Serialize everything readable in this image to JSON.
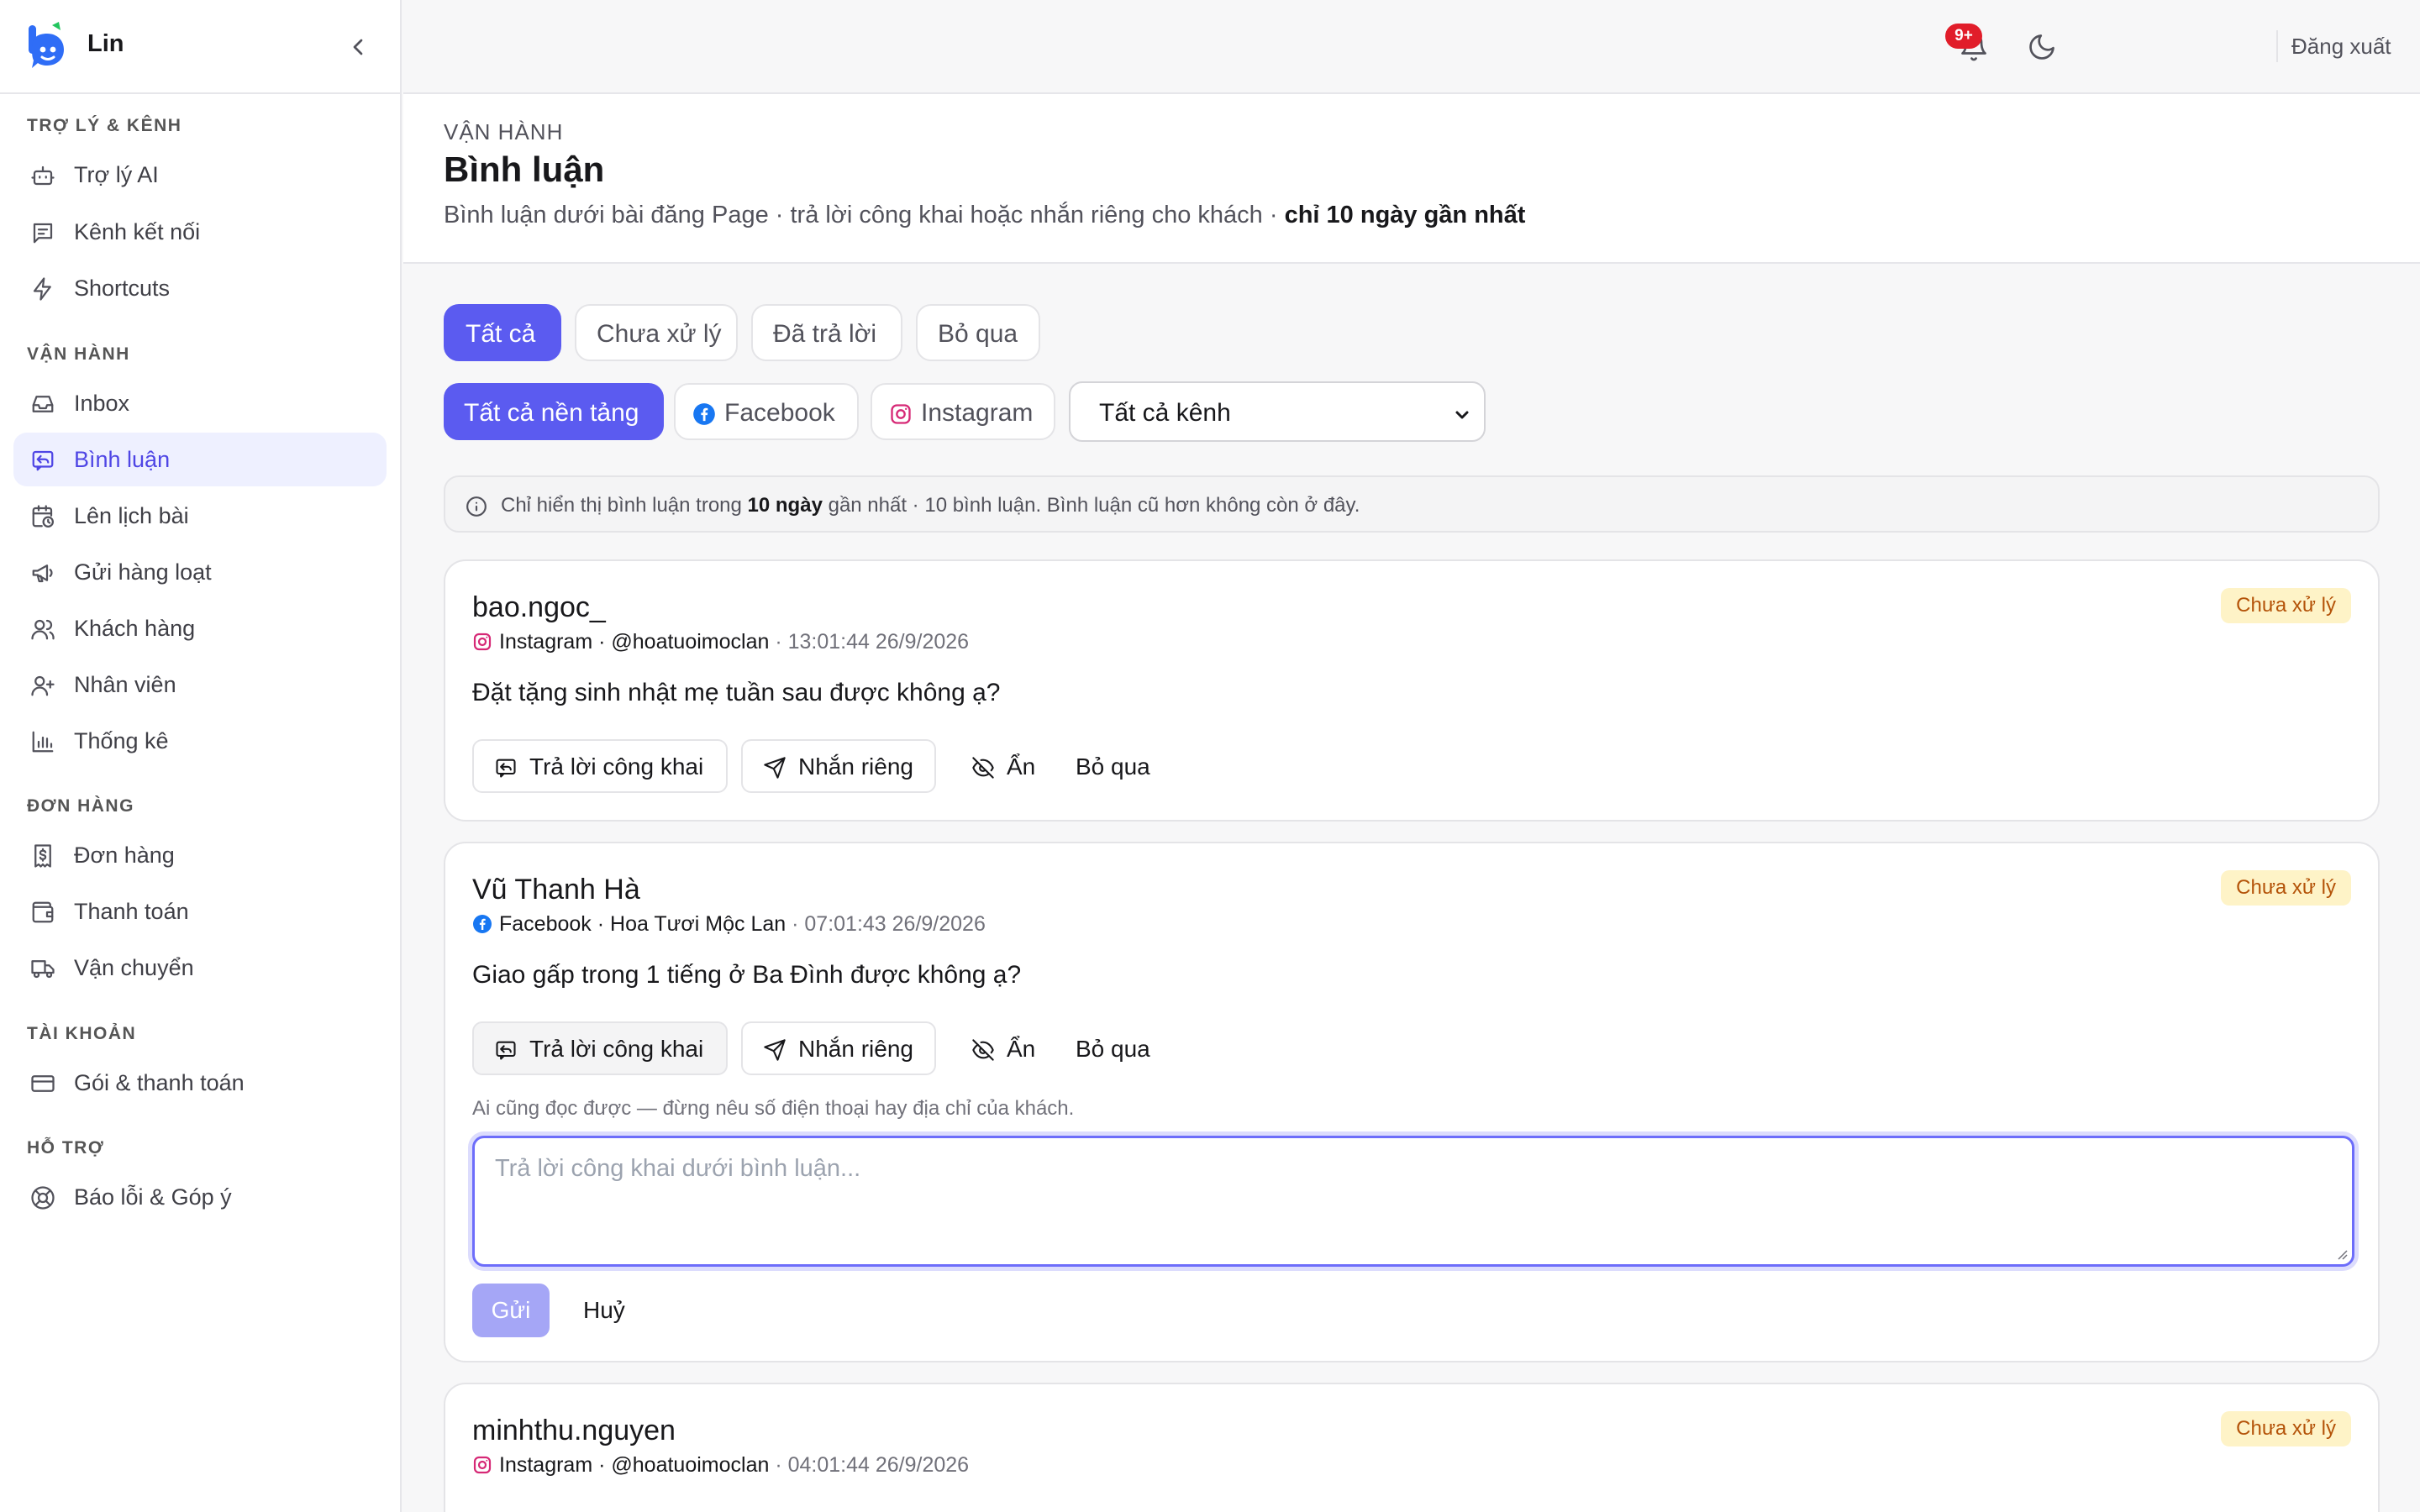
{
  "brand": {
    "name": "Lin",
    "accent": "#5b5bf0"
  },
  "sidebar": {
    "sections": [
      {
        "title": "TRỢ LÝ & KÊNH",
        "items": [
          {
            "label": "Trợ lý AI",
            "icon": "bot-icon"
          },
          {
            "label": "Kênh kết nối",
            "icon": "channels-icon"
          },
          {
            "label": "Shortcuts",
            "icon": "zap-icon"
          }
        ]
      },
      {
        "title": "VẬN HÀNH",
        "items": [
          {
            "label": "Inbox",
            "icon": "inbox-icon"
          },
          {
            "label": "Bình luận",
            "icon": "comment-reply-icon",
            "active": true
          },
          {
            "label": "Lên lịch bài",
            "icon": "calendar-clock-icon"
          },
          {
            "label": "Gửi hàng loạt",
            "icon": "megaphone-icon"
          },
          {
            "label": "Khách hàng",
            "icon": "users-icon"
          },
          {
            "label": "Nhân viên",
            "icon": "user-plus-icon"
          },
          {
            "label": "Thống kê",
            "icon": "bar-chart-icon"
          }
        ]
      },
      {
        "title": "ĐƠN HÀNG",
        "items": [
          {
            "label": "Đơn hàng",
            "icon": "receipt-icon"
          },
          {
            "label": "Thanh toán",
            "icon": "wallet-icon"
          },
          {
            "label": "Vận chuyển",
            "icon": "truck-icon"
          }
        ]
      },
      {
        "title": "TÀI KHOẢN",
        "items": [
          {
            "label": "Gói & thanh toán",
            "icon": "credit-card-icon"
          }
        ]
      },
      {
        "title": "HỖ TRỢ",
        "items": [
          {
            "label": "Báo lỗi & Góp ý",
            "icon": "lifebuoy-icon"
          }
        ]
      }
    ]
  },
  "topbar": {
    "notification_badge": "9+",
    "logout": "Đăng xuất"
  },
  "page": {
    "eyebrow": "VẬN HÀNH",
    "title": "Bình luận",
    "subtitle": "Bình luận dưới bài đăng Page · trả lời công khai hoặc nhắn riêng cho khách · ",
    "subtitle_bold": "chỉ 10 ngày gần nhất"
  },
  "filters": {
    "status_tabs": [
      {
        "label": "Tất cả",
        "active": true
      },
      {
        "label": "Chưa xử lý",
        "active": false
      },
      {
        "label": "Đã trả lời",
        "active": false
      },
      {
        "label": "Bỏ qua",
        "active": false
      }
    ],
    "platform_tabs": [
      {
        "label": "Tất cả nền tảng",
        "active": true
      },
      {
        "label": "Facebook",
        "icon": "facebook-icon",
        "active": false
      },
      {
        "label": "Instagram",
        "icon": "instagram-icon",
        "active": false
      }
    ],
    "channel_select": {
      "value": "Tất cả kênh"
    }
  },
  "info_banner": {
    "prefix": "Chỉ hiển thị bình luận trong ",
    "bold": "10 ngày",
    "suffix": " gần nhất · 10 bình luận. Bình luận cũ hơn không còn ở đây."
  },
  "comments": [
    {
      "author": "bao.ngoc_",
      "platform": "Instagram",
      "page": "@hoatuoimoclan",
      "time": "13:01:44 26/9/2026",
      "text": "Đặt tặng sinh nhật mẹ tuần sau được không ạ?",
      "status": "Chưa xử lý"
    },
    {
      "author": "Vũ Thanh Hà",
      "platform": "Facebook",
      "page": "Hoa Tươi Mộc Lan",
      "time": "07:01:43 26/9/2026",
      "text": "Giao gấp trong 1 tiếng ở Ba Đình được không ạ?",
      "status": "Chưa xử lý",
      "reply_open": true,
      "reply_hint": "Ai cũng đọc được — đừng nêu số điện thoại hay địa chỉ của khách.",
      "reply_placeholder": "Trả lời công khai dưới bình luận...",
      "send_label": "Gửi",
      "cancel_label": "Huỷ"
    },
    {
      "author": "minhthu.nguyen",
      "platform": "Instagram",
      "page": "@hoatuoimoclan",
      "time": "04:01:44 26/9/2026",
      "text": "",
      "status": "Chưa xử lý"
    }
  ],
  "actions": {
    "reply_public": "Trả lời công khai",
    "message_private": "Nhắn riêng",
    "hide": "Ẩn",
    "ignore": "Bỏ qua"
  }
}
